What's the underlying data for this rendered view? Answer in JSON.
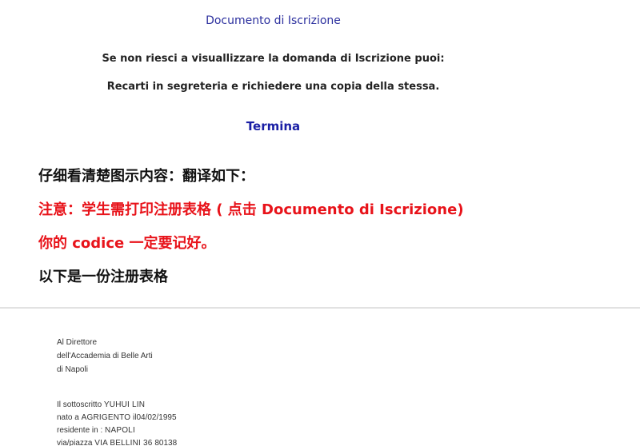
{
  "screen": {
    "document_link": "Documento di Iscrizione",
    "message_line1": "Se non riesci a visuallizzare la domanda di Iscrizione puoi:",
    "message_line2": "Recarti in segreteria e richiedere una copia della stessa.",
    "termina_link": "Termina"
  },
  "notes": {
    "line1": "仔细看清楚图示内容：翻译如下：",
    "line2": "注意：学生需打印注册表格 ( 点击 Documento di Iscrizione)",
    "line3": "你的 codice  一定要记好。",
    "line4": "以下是一份注册表格"
  },
  "form": {
    "recipient_line1": "Al Direttore",
    "recipient_line2": "dell'Accademia di Belle Arti",
    "recipient_line3": "di Napoli",
    "signer_prefix": "Il sottoscritto",
    "signer_name": "YUHUI LIN",
    "birth_prefix": "nato a",
    "birth_place": "AGRIGENTO",
    "birth_mid": "il",
    "birth_date": "04/02/1995",
    "residence_prefix": "residente in :",
    "residence_city": "NAPOLI",
    "address_prefix": "via/piazza",
    "address_value": "VIA BELLINI 36",
    "address_zip": "80138"
  },
  "colors": {
    "link_blue": "#2b2f9e",
    "termina_blue": "#1a1fa5",
    "note_red": "#e8131a",
    "note_black": "#111111"
  }
}
